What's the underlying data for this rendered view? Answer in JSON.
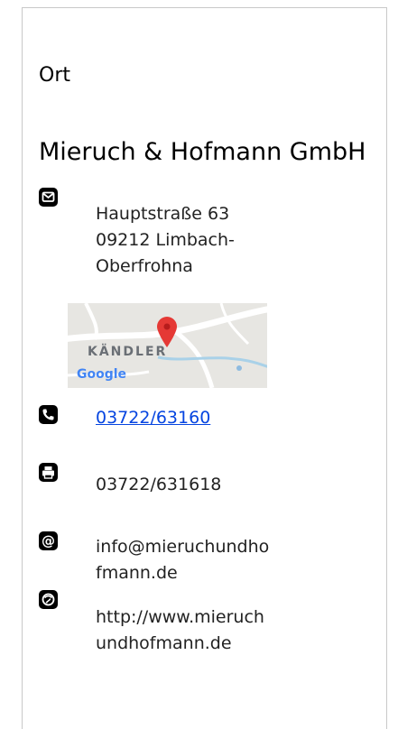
{
  "section": {
    "title": "Ort"
  },
  "company": {
    "name": "Mieruch & Hofmann GmbH"
  },
  "address": {
    "icon": "mail-icon",
    "street": "Hauptstraße 63",
    "city_line1": "09212 Limbach-",
    "city_line2": "Oberfrohna"
  },
  "map": {
    "label": "KÄNDLER",
    "attribution": "Google",
    "pin_color": "#e53935"
  },
  "phone": {
    "icon": "phone-icon",
    "number": "03722/63160",
    "link_color": "#0645e0"
  },
  "fax": {
    "icon": "fax-icon",
    "number": "03722/631618"
  },
  "email": {
    "icon": "at-icon",
    "line1": "info@mieruchundho",
    "line2": "fmann.de"
  },
  "website": {
    "icon": "web-icon",
    "line1": "http://www.mieruch",
    "line2": "undhofmann.de"
  }
}
